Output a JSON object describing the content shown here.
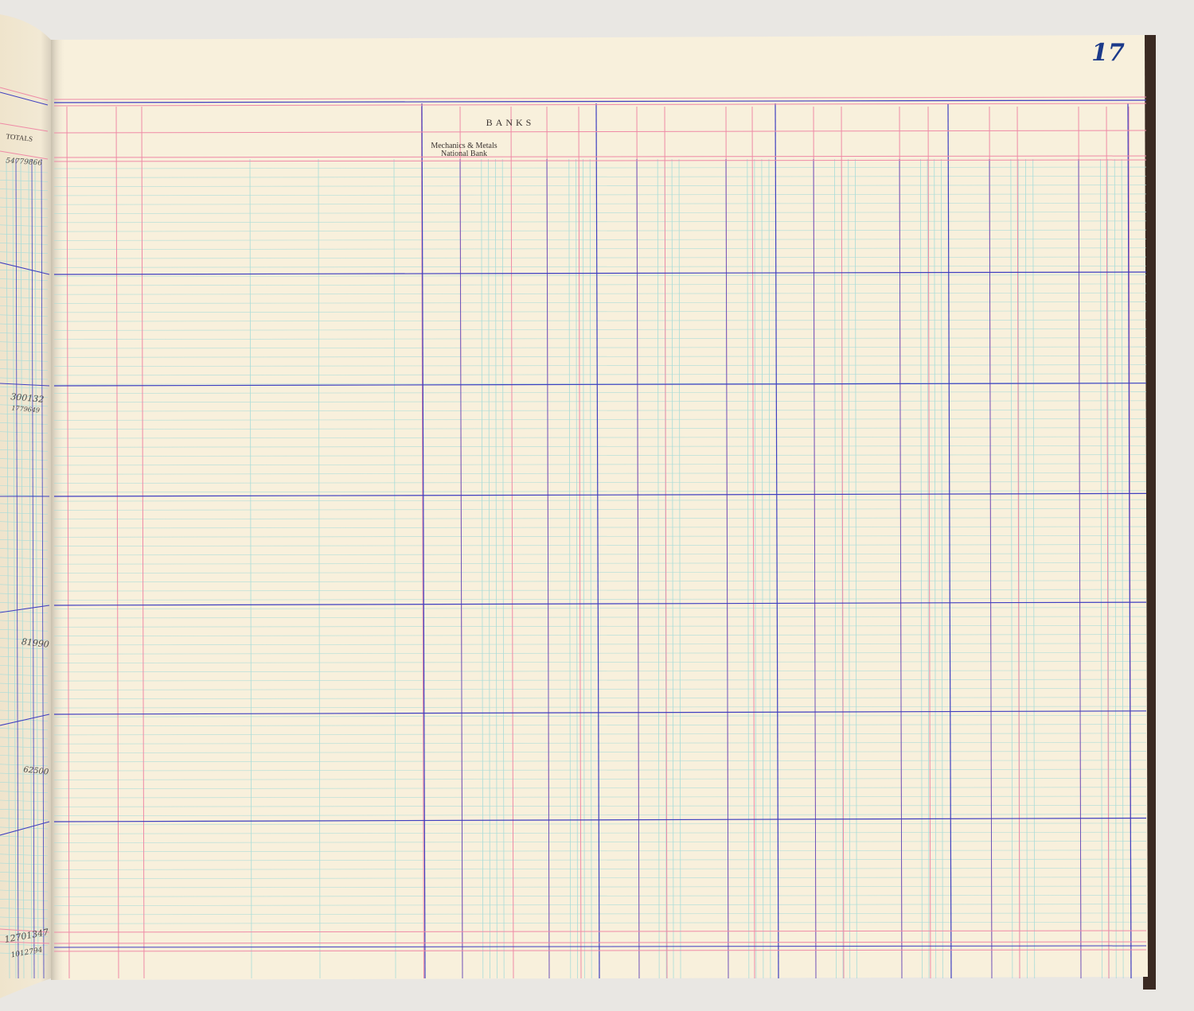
{
  "page_number": "17",
  "header": {
    "group_title": "BANKS",
    "bank_column_line1": "Mechanics & Metals",
    "bank_column_line2": "National Bank"
  },
  "left_page": {
    "column_header": "TOTALS",
    "handwritten_entries": [
      "54779866",
      "300132",
      "1779649",
      "81990",
      "62500",
      "12701347",
      "1012794"
    ]
  },
  "colors": {
    "paper": "#f8f0dc",
    "ruling_blue": "#3f3fc0",
    "ruling_red": "#ef8aa6",
    "ruling_cyan": "#a9dcd8",
    "page_number_ink": "#1c3a8a"
  }
}
